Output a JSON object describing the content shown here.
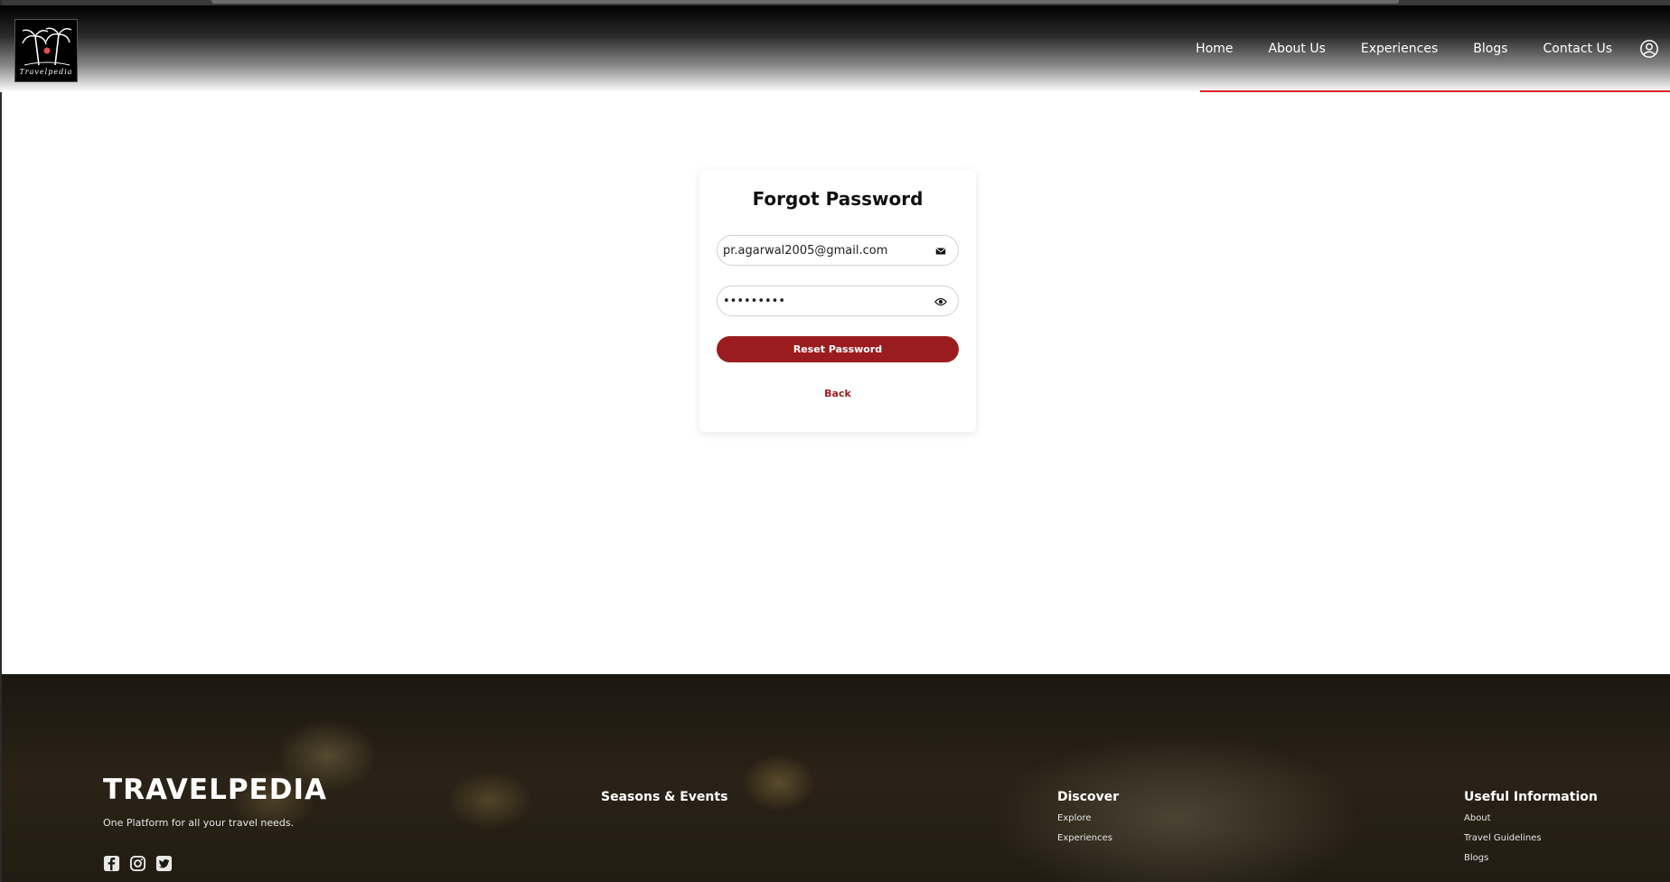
{
  "brand": {
    "logo_text": "Travelpedia"
  },
  "nav": {
    "items": [
      "Home",
      "About Us",
      "Experiences",
      "Blogs",
      "Contact Us"
    ],
    "user_icon": "user-circle-icon"
  },
  "form": {
    "title": "Forgot Password",
    "email_value": "pr.agarwal2005@gmail.com",
    "email_icon": "envelope-icon",
    "password_value": "•••••••••",
    "password_icon": "eye-icon",
    "reset_label": "Reset Password",
    "back_label": "Back"
  },
  "footer": {
    "brand_title": "TRAVELPEDIA",
    "tagline": "One Platform for all your travel needs.",
    "social_icons": [
      "facebook-icon",
      "instagram-icon",
      "twitter-icon"
    ],
    "columns": [
      {
        "heading": "Seasons & Events",
        "links": []
      },
      {
        "heading": "Discover",
        "links": [
          "Explore",
          "Experiences"
        ]
      },
      {
        "heading": "Useful Information",
        "links": [
          "About",
          "Travel Guidelines",
          "Blogs"
        ]
      }
    ]
  },
  "colors": {
    "accent": "#9b1c1f",
    "nav_underline": "#d9252a"
  }
}
